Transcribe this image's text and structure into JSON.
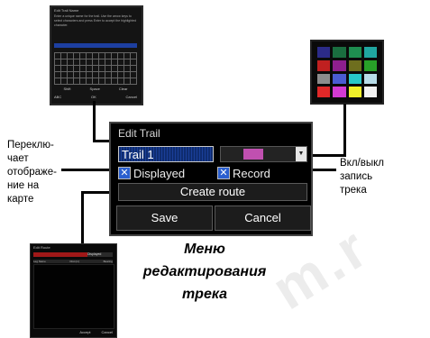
{
  "keyboard_screen": {
    "title": "Edit Trail Name",
    "text": "Enter a unique name for the trail. Use the arrow keys to select characters and press Enter to accept the highlighted character.",
    "buttons_row1": [
      "Shift",
      "Space",
      "Clear"
    ],
    "buttons_row2": [
      "ABC",
      "OK",
      "Cancel"
    ]
  },
  "color_picker": {
    "colors": [
      "#2b2b88",
      "#1a6e3f",
      "#1e8e50",
      "#20a6a0",
      "#c02020",
      "#8e1f8e",
      "#6e6e1e",
      "#28a028",
      "#8c8c8c",
      "#4a5cd2",
      "#28c8c8",
      "#b8dce8",
      "#e02828",
      "#d23ad2",
      "#f0f02a",
      "#f2f2f2"
    ]
  },
  "dialog": {
    "title": "Edit Trail",
    "name_value": "Trail 1",
    "trail_color": "#c050b0",
    "displayed_label": "Displayed",
    "record_label": "Record",
    "check_mark": "✕",
    "dropdown_arrow": "▼",
    "create_route_label": "Create route",
    "save_label": "Save",
    "cancel_label": "Cancel"
  },
  "labels": {
    "left_lines": [
      "Переклю-",
      "чает",
      "отображе-",
      "ние на",
      "карте"
    ],
    "right_lines": [
      "Вкл/выкл",
      "запись",
      "трека"
    ]
  },
  "caption": {
    "lines": [
      "Меню",
      "редактирования",
      "трека"
    ]
  },
  "route_screen": {
    "title": "Edit Route",
    "selected": "Displayed",
    "columns": [
      "Leg Name",
      "Dist (m)",
      "Bearing"
    ],
    "buttons": [
      "Accept",
      "Cancel"
    ]
  }
}
